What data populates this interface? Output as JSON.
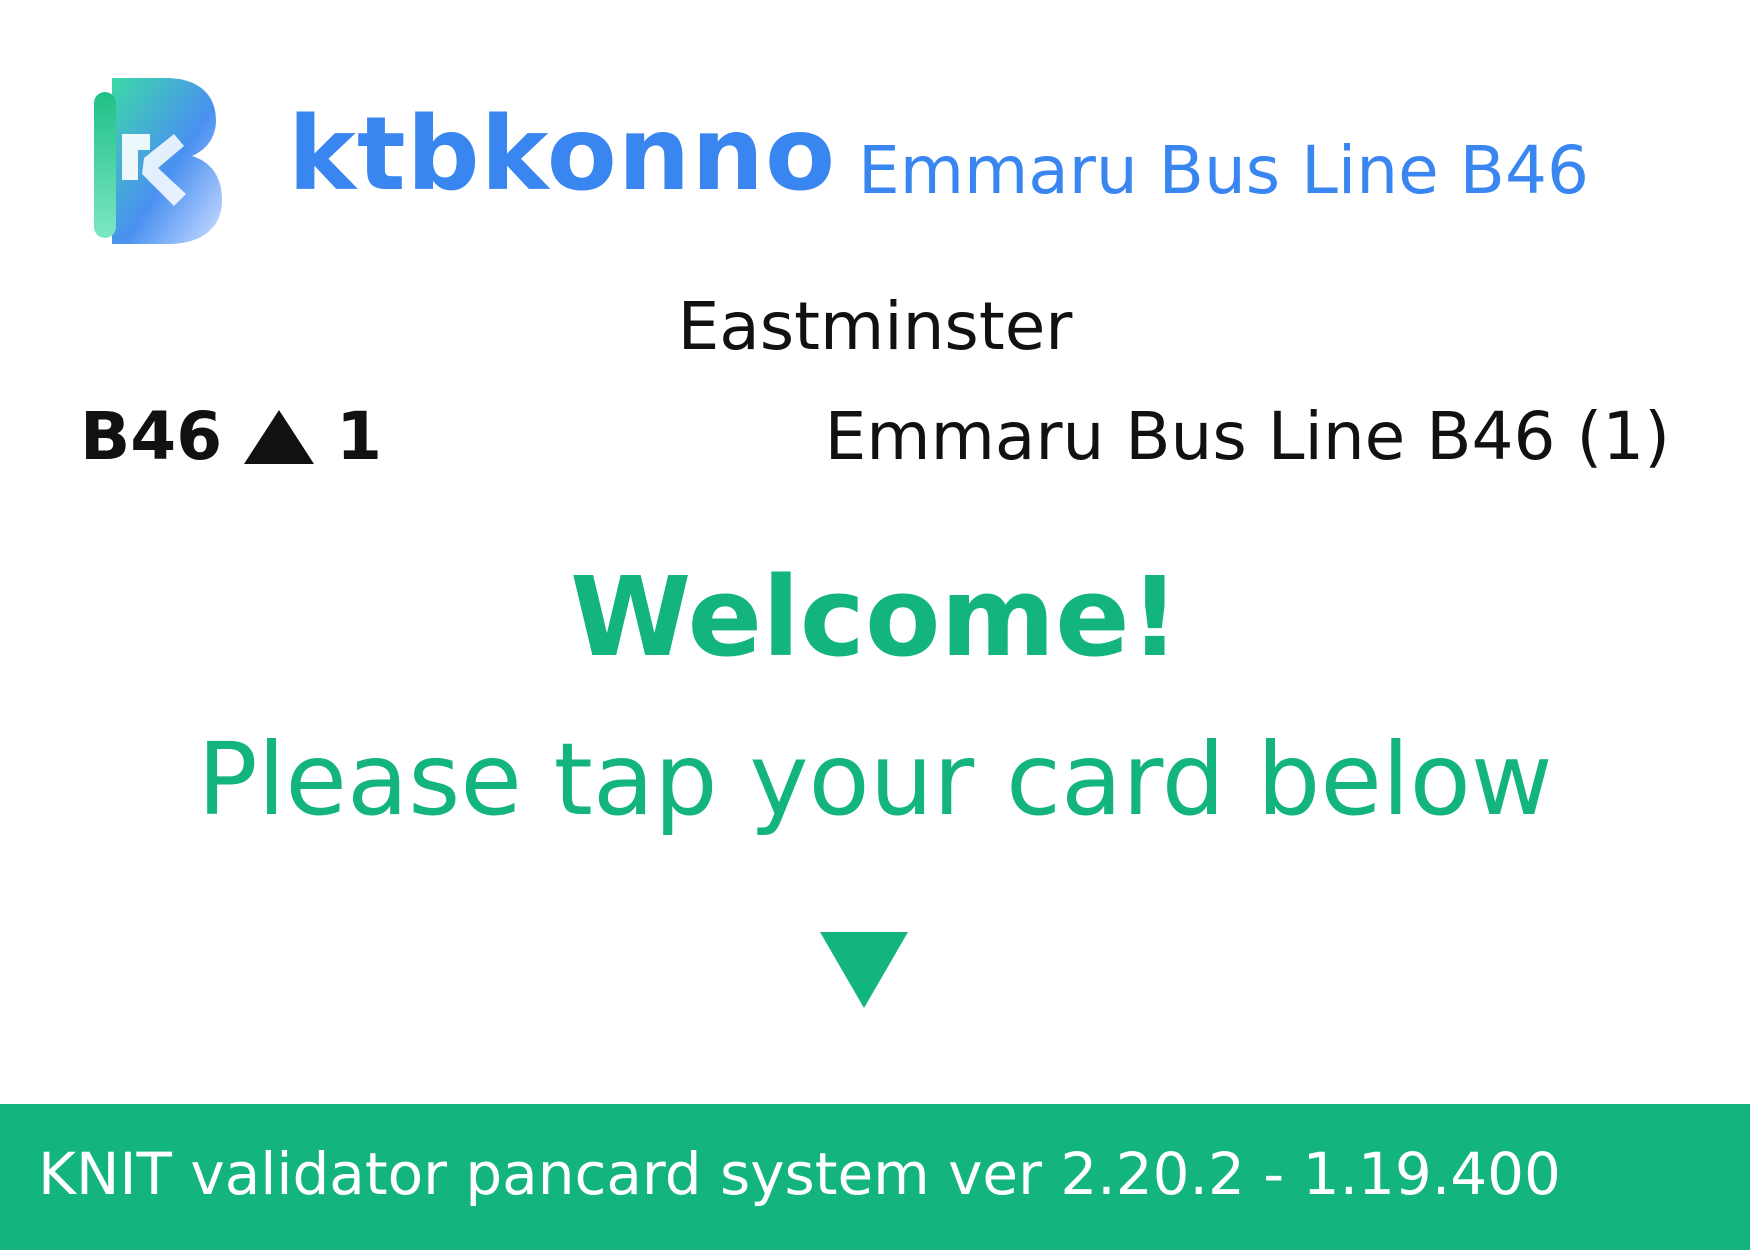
{
  "header": {
    "logo_icon": "ktbkonno-b-logo-icon",
    "brand_name": "ktbkonno",
    "line_name": "Emmaru Bus Line B46",
    "brand_color": "#3a86f0"
  },
  "stop": {
    "name": "Eastminster"
  },
  "route": {
    "code": "B46",
    "direction_icon": "up-triangle-icon",
    "direction": "1",
    "full_name": "Emmaru Bus Line B46 (1)"
  },
  "prompt": {
    "welcome": "Welcome!",
    "instruction": "Please tap your card below",
    "arrow_icon": "down-triangle-icon",
    "accent_color": "#13b47f"
  },
  "footer": {
    "text": "KNIT validator pancard system ver 2.20.2 - 1.19.400",
    "background_color": "#13b47f"
  }
}
